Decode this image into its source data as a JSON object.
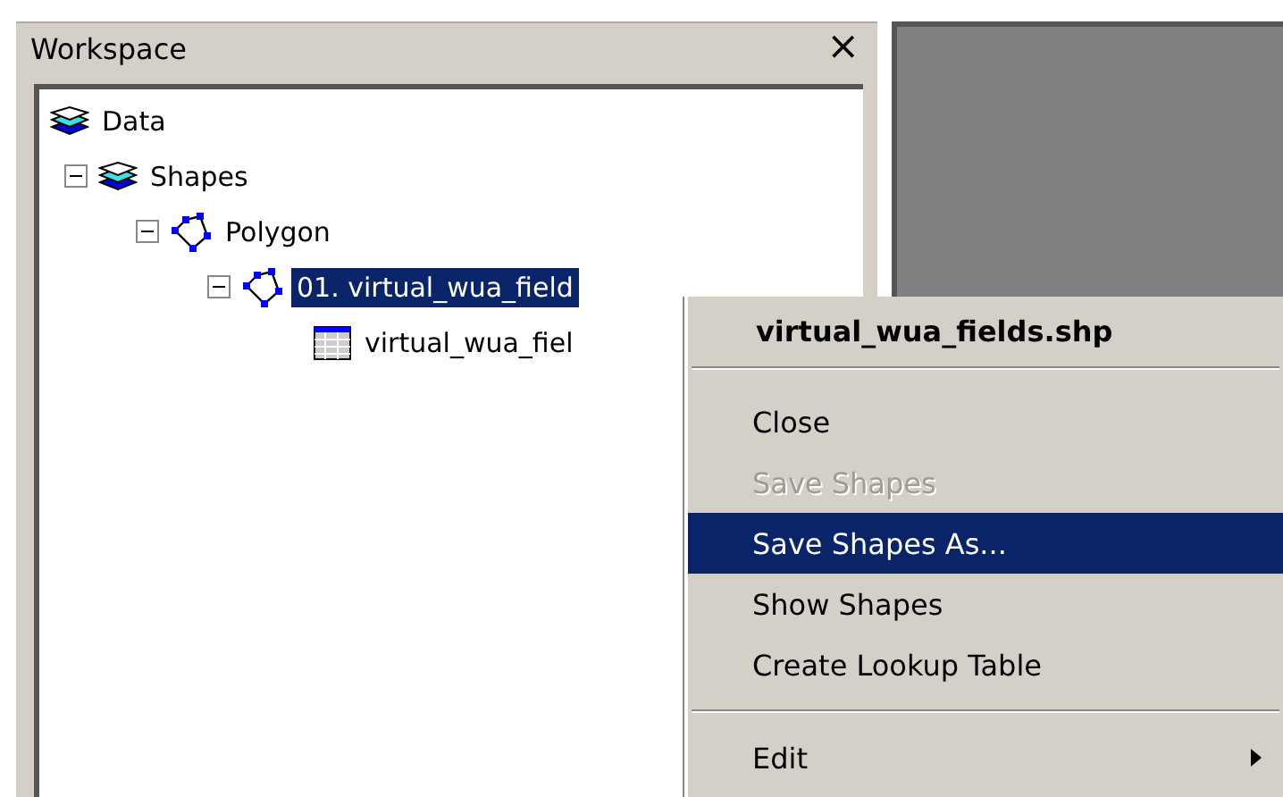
{
  "panel": {
    "title": "Workspace",
    "close": "×"
  },
  "tree": [
    {
      "label": "Data",
      "kind": "layers",
      "selected": false,
      "children": [
        {
          "label": "Shapes",
          "kind": "layers",
          "expanded": true,
          "selected": false,
          "children": [
            {
              "label": "Polygon",
              "kind": "polygon",
              "expanded": true,
              "selected": false,
              "children": [
                {
                  "label": "01. virtual_wua_field",
                  "kind": "polygon",
                  "expanded": true,
                  "selected": true,
                  "children": [
                    {
                      "label": "virtual_wua_fiel",
                      "kind": "table",
                      "selected": false
                    }
                  ]
                }
              ]
            }
          ]
        }
      ]
    }
  ],
  "context_menu": {
    "title": "virtual_wua_fields.shp",
    "items": [
      {
        "kind": "item",
        "label": "Close",
        "disabled": false,
        "selected": false,
        "submenu": false
      },
      {
        "kind": "item",
        "label": "Save Shapes",
        "disabled": true,
        "selected": false,
        "submenu": false
      },
      {
        "kind": "item",
        "label": "Save Shapes As...",
        "disabled": false,
        "selected": true,
        "submenu": false
      },
      {
        "kind": "item",
        "label": "Show Shapes",
        "disabled": false,
        "selected": false,
        "submenu": false
      },
      {
        "kind": "item",
        "label": "Create Lookup Table",
        "disabled": false,
        "selected": false,
        "submenu": false
      },
      {
        "kind": "separator"
      },
      {
        "kind": "item",
        "label": "Edit",
        "disabled": false,
        "selected": false,
        "submenu": true
      }
    ]
  }
}
